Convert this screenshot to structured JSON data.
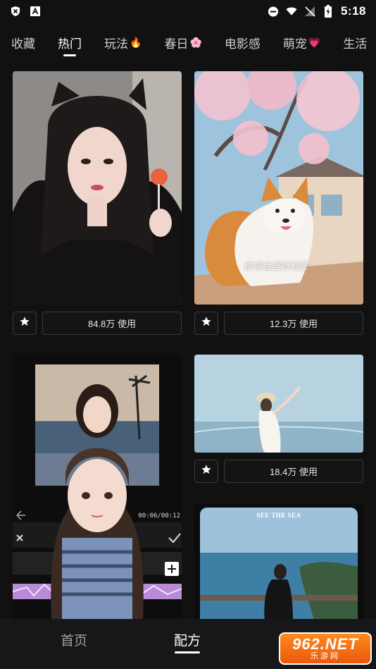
{
  "status_bar": {
    "time": "5:18",
    "left_icons": [
      "shield-x-icon",
      "text-a-icon"
    ],
    "right_icons": [
      "do-not-disturb-icon",
      "wifi-icon",
      "no-signal-icon",
      "battery-charging-icon"
    ]
  },
  "tabs": [
    {
      "label": "收藏",
      "emoji": ""
    },
    {
      "label": "热门",
      "emoji": "",
      "active": true
    },
    {
      "label": "玩法",
      "emoji": "🔥"
    },
    {
      "label": "春日",
      "emoji": "🌸"
    },
    {
      "label": "电影感",
      "emoji": ""
    },
    {
      "label": "萌宠",
      "emoji": "💗"
    },
    {
      "label": "生活",
      "emoji": ""
    }
  ],
  "cards": [
    {
      "usage": "84.8万 使用",
      "caption": ""
    },
    {
      "usage": "12.3万 使用",
      "caption": "你将会坚持到底"
    },
    {
      "usage": "",
      "caption": "00:06/00:12"
    },
    {
      "usage": "18.4万 使用",
      "caption": ""
    },
    {
      "usage": "",
      "caption": "SEE THE SEA"
    }
  ],
  "bottom_nav": {
    "home": "首页",
    "recipe": "配方"
  },
  "watermark": {
    "top": "962.NET",
    "bottom": "乐游网"
  }
}
